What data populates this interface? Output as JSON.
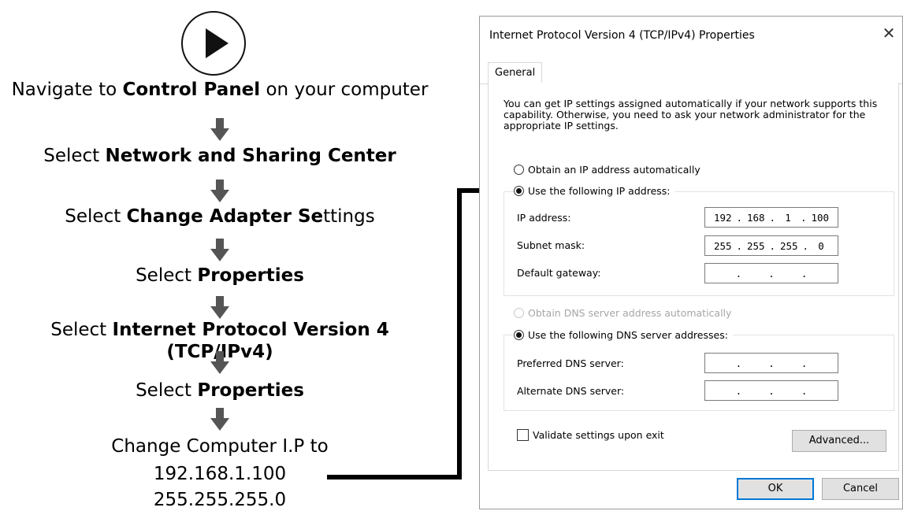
{
  "flow": {
    "steps": [
      {
        "prefix": "Navigate to ",
        "bold": "Control Panel",
        "suffix": " on your computer"
      },
      {
        "prefix": "Select ",
        "bold": "Network and Sharing Center",
        "suffix": ""
      },
      {
        "prefix": "Select ",
        "bold": "Change Adapter Se",
        "suffix": "ttings"
      },
      {
        "prefix": "Select ",
        "bold": "Properties",
        "suffix": ""
      },
      {
        "prefix": "Select ",
        "bold": "Internet Protocol Version 4 (TCP/IPv4)",
        "suffix": ""
      },
      {
        "prefix": "Select ",
        "bold": "Properties",
        "suffix": ""
      }
    ],
    "result_lines": [
      "Change Computer I.P to",
      "192.168.1.100",
      "255.255.255.0"
    ]
  },
  "dialog": {
    "title": "Internet Protocol Version 4 (TCP/IPv4) Properties",
    "close_glyph": "✕",
    "tab_general": "General",
    "intro": "You can get IP settings assigned automatically if your network supports this capability. Otherwise, you need to ask your network administrator for the appropriate IP settings.",
    "ip_auto_label": "Obtain an IP address automatically",
    "ip_manual_label": "Use the following IP address:",
    "ip_address_label": "IP address:",
    "ip_address": [
      "192",
      "168",
      "1",
      "100"
    ],
    "subnet_label": "Subnet mask:",
    "subnet": [
      "255",
      "255",
      "255",
      "0"
    ],
    "gateway_label": "Default gateway:",
    "gateway": [
      "",
      "",
      "",
      ""
    ],
    "dns_auto_label": "Obtain DNS server address automatically",
    "dns_manual_label": "Use the following DNS server addresses:",
    "preferred_dns_label": "Preferred DNS server:",
    "preferred_dns": [
      "",
      "",
      "",
      ""
    ],
    "alternate_dns_label": "Alternate DNS server:",
    "alternate_dns": [
      "",
      "",
      "",
      ""
    ],
    "validate_label": "Validate settings upon exit",
    "advanced_label": "Advanced...",
    "ok_label": "OK",
    "cancel_label": "Cancel",
    "default_button_color": "#0078d7"
  }
}
